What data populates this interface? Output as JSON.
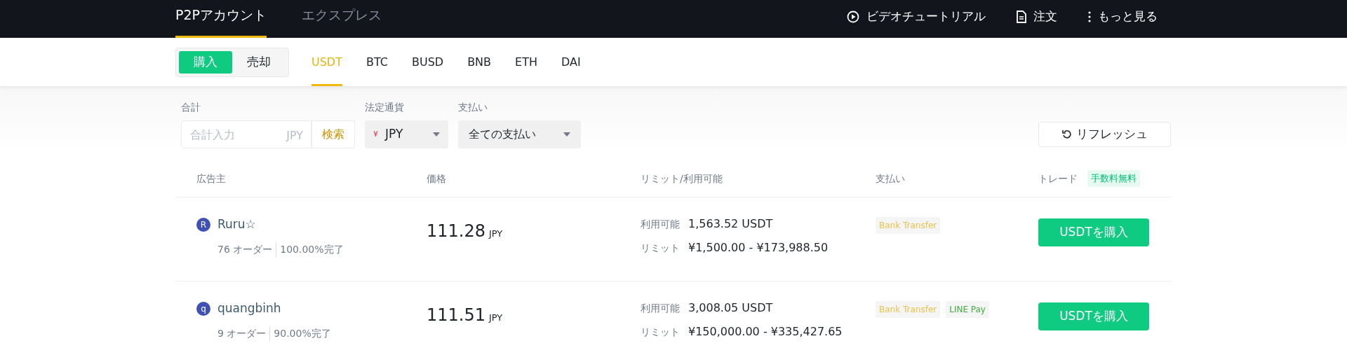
{
  "top_nav": {
    "tabs": [
      {
        "label": "P2Pアカウント",
        "selected": true
      },
      {
        "label": "エクスプレス",
        "selected": false
      }
    ],
    "links": [
      {
        "kind": "video",
        "label": "ビデオチュートリアル"
      },
      {
        "kind": "orders",
        "label": "注文"
      },
      {
        "kind": "more",
        "label": "もっと見る"
      }
    ]
  },
  "side_toggle": [
    {
      "label": "購入",
      "selected": true
    },
    {
      "label": "売却",
      "selected": false
    }
  ],
  "assets": [
    {
      "label": "USDT",
      "selected": true
    },
    {
      "label": "BTC",
      "selected": false
    },
    {
      "label": "BUSD",
      "selected": false
    },
    {
      "label": "BNB",
      "selected": false
    },
    {
      "label": "ETH",
      "selected": false
    },
    {
      "label": "DAI",
      "selected": false
    }
  ],
  "filters": {
    "amount": {
      "label": "合計",
      "placeholder": "合計入力",
      "unit": "JPY",
      "search": "検索"
    },
    "fiat": {
      "label": "法定通貨",
      "symbol": "¥",
      "value": "JPY"
    },
    "payment": {
      "label": "支払い",
      "value": "全ての支払い"
    },
    "refresh": "リフレッシュ"
  },
  "table": {
    "columns": [
      "広告主",
      "価格",
      "リミット/利用可能",
      "支払い",
      "トレード"
    ],
    "fee_badge": "手数料無料",
    "rows": [
      {
        "avatar": "R",
        "name": "Ruru☆",
        "orders": "76 オーダー",
        "completion": "100.00%完了",
        "price": "111.28",
        "currency": "JPY",
        "available_label": "利用可能",
        "available": "1,563.52 USDT",
        "limit_label": "リミット",
        "limit": "¥1,500.00 - ¥173,988.50",
        "payments": [
          {
            "label": "Bank Transfer",
            "color": "#e6c34a"
          }
        ],
        "action": "USDTを購入"
      },
      {
        "avatar": "q",
        "name": "quangbinh",
        "orders": "9 オーダー",
        "completion": "90.00%完了",
        "price": "111.51",
        "currency": "JPY",
        "available_label": "利用可能",
        "available": "3,008.05 USDT",
        "limit_label": "リミット",
        "limit": "¥150,000.00 - ¥335,427.65",
        "payments": [
          {
            "label": "Bank Transfer",
            "color": "#e6c34a"
          },
          {
            "label": "LINE Pay",
            "color": "#3fae3f"
          }
        ],
        "action": "USDTを購入"
      }
    ]
  }
}
